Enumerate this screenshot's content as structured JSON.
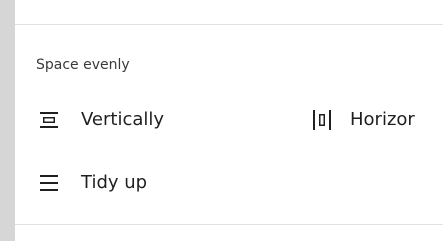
{
  "space_evenly": {
    "title": "Space evenly",
    "vertically_label": "Vertically",
    "horizontally_label": "Horizor"
  },
  "tidy_up": {
    "label": "Tidy up"
  },
  "icons": {
    "vertical": "distribute-vertical-icon",
    "horizontal": "distribute-horizontal-icon",
    "tidy": "tidy-up-icon"
  }
}
